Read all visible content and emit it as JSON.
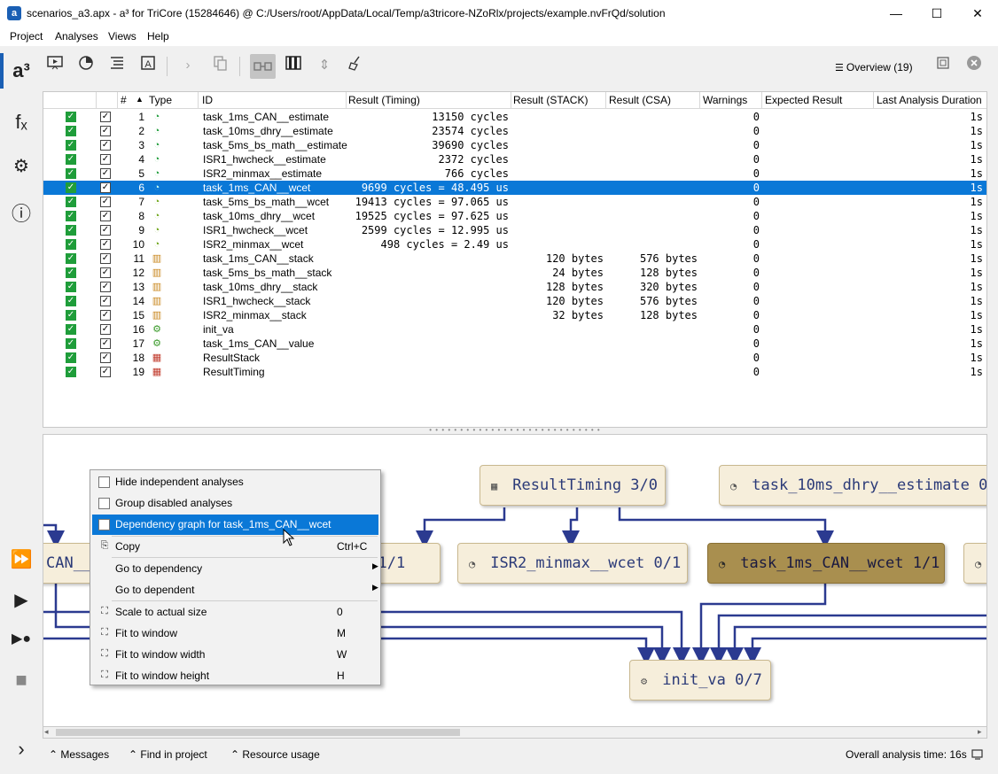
{
  "window": {
    "title": "scenarios_a3.apx - a³ for TriCore (15284646) @ C:/Users/root/AppData/Local/Temp/a3tricore-NZoRlx/projects/example.nvFrQd/solution",
    "minimize": "—",
    "maximize": "☐",
    "close": "✕"
  },
  "menu": {
    "project": "Project",
    "analyses": "Analyses",
    "views": "Views",
    "help": "Help"
  },
  "rail": {
    "logo": "a³",
    "functions": "fₓ",
    "settings": "⚙",
    "info": "ⓘ",
    "run_all": "⏩",
    "run": "▶",
    "run_selected": "▶●",
    "stop": "■",
    "expand": "›"
  },
  "toolbar": {
    "overview_label": "Overview (19)"
  },
  "table": {
    "headers": {
      "hash": "#",
      "type": "Type",
      "id": "ID",
      "timing": "Result (Timing)",
      "stack": "Result (STACK)",
      "csa": "Result (CSA)",
      "warnings": "Warnings",
      "expected": "Expected Result",
      "duration": "Last Analysis Duration"
    },
    "rows": [
      {
        "num": "1",
        "type": "estimate",
        "id": "task_1ms_CAN__estimate",
        "timing": "13150 cycles",
        "stack": "",
        "csa": "",
        "warnings": "0",
        "duration": "1s"
      },
      {
        "num": "2",
        "type": "estimate",
        "id": "task_10ms_dhry__estimate",
        "timing": "23574 cycles",
        "stack": "",
        "csa": "",
        "warnings": "0",
        "duration": "1s"
      },
      {
        "num": "3",
        "type": "estimate",
        "id": "task_5ms_bs_math__estimate",
        "timing": "39690 cycles",
        "stack": "",
        "csa": "",
        "warnings": "0",
        "duration": "1s"
      },
      {
        "num": "4",
        "type": "estimate",
        "id": "ISR1_hwcheck__estimate",
        "timing": "2372 cycles",
        "stack": "",
        "csa": "",
        "warnings": "0",
        "duration": "1s"
      },
      {
        "num": "5",
        "type": "estimate",
        "id": "ISR2_minmax__estimate",
        "timing": "766 cycles",
        "stack": "",
        "csa": "",
        "warnings": "0",
        "duration": "1s"
      },
      {
        "num": "6",
        "type": "wcet",
        "id": "task_1ms_CAN__wcet",
        "timing": "9699 cycles = 48.495 us",
        "stack": "",
        "csa": "",
        "warnings": "0",
        "duration": "1s"
      },
      {
        "num": "7",
        "type": "wcet",
        "id": "task_5ms_bs_math__wcet",
        "timing": "19413 cycles = 97.065 us",
        "stack": "",
        "csa": "",
        "warnings": "0",
        "duration": "1s"
      },
      {
        "num": "8",
        "type": "wcet",
        "id": "task_10ms_dhry__wcet",
        "timing": "19525 cycles = 97.625 us",
        "stack": "",
        "csa": "",
        "warnings": "0",
        "duration": "1s"
      },
      {
        "num": "9",
        "type": "wcet",
        "id": "ISR1_hwcheck__wcet",
        "timing": "2599 cycles = 12.995 us",
        "stack": "",
        "csa": "",
        "warnings": "0",
        "duration": "1s"
      },
      {
        "num": "10",
        "type": "wcet",
        "id": "ISR2_minmax__wcet",
        "timing": "498 cycles = 2.49 us",
        "stack": "",
        "csa": "",
        "warnings": "0",
        "duration": "1s"
      },
      {
        "num": "11",
        "type": "stack",
        "id": "task_1ms_CAN__stack",
        "timing": "",
        "stack": "120 bytes",
        "csa": "576 bytes",
        "warnings": "0",
        "duration": "1s"
      },
      {
        "num": "12",
        "type": "stack",
        "id": "task_5ms_bs_math__stack",
        "timing": "",
        "stack": "24 bytes",
        "csa": "128 bytes",
        "warnings": "0",
        "duration": "1s"
      },
      {
        "num": "13",
        "type": "stack",
        "id": "task_10ms_dhry__stack",
        "timing": "",
        "stack": "128 bytes",
        "csa": "320 bytes",
        "warnings": "0",
        "duration": "1s"
      },
      {
        "num": "14",
        "type": "stack",
        "id": "ISR1_hwcheck__stack",
        "timing": "",
        "stack": "120 bytes",
        "csa": "576 bytes",
        "warnings": "0",
        "duration": "1s"
      },
      {
        "num": "15",
        "type": "stack",
        "id": "ISR2_minmax__stack",
        "timing": "",
        "stack": "32 bytes",
        "csa": "128 bytes",
        "warnings": "0",
        "duration": "1s"
      },
      {
        "num": "16",
        "type": "value",
        "id": "init_va",
        "timing": "",
        "stack": "",
        "csa": "",
        "warnings": "0",
        "duration": "1s"
      },
      {
        "num": "17",
        "type": "value",
        "id": "task_1ms_CAN__value",
        "timing": "",
        "stack": "",
        "csa": "",
        "warnings": "0",
        "duration": "1s"
      },
      {
        "num": "18",
        "type": "report",
        "id": "ResultStack",
        "timing": "",
        "stack": "",
        "csa": "",
        "warnings": "0",
        "duration": "1s"
      },
      {
        "num": "19",
        "type": "report",
        "id": "ResultTiming",
        "timing": "",
        "stack": "",
        "csa": "",
        "warnings": "0",
        "duration": "1s"
      }
    ],
    "selected_row": 6
  },
  "graph": {
    "nodes": {
      "result_timing": "ResultTiming 3/0",
      "dhry_estimate": "task_10ms_dhry__estimate 0/",
      "can_left": "CAN__",
      "wcet_partial": "t 1/1",
      "isr2_wcet": "ISR2_minmax__wcet 0/1",
      "can_wcet": "task_1ms_CAN__wcet 1/1",
      "init_va": "init_va 0/7"
    }
  },
  "context_menu": {
    "hide_independent": "Hide independent analyses",
    "group_disabled": "Group disabled analyses",
    "dependency_graph": "Dependency graph for task_1ms_CAN__wcet",
    "copy": "Copy",
    "copy_shortcut": "Ctrl+C",
    "goto_dependency": "Go to dependency",
    "goto_dependent": "Go to dependent",
    "scale_actual": "Scale to actual size",
    "scale_actual_shortcut": "0",
    "fit_window": "Fit to window",
    "fit_window_shortcut": "M",
    "fit_width": "Fit to window width",
    "fit_width_shortcut": "W",
    "fit_height": "Fit to window height",
    "fit_height_shortcut": "H"
  },
  "bottom": {
    "messages": "Messages",
    "find_in_project": "Find in project",
    "resource_usage": "Resource usage",
    "overall_time": "Overall analysis time: 16s"
  }
}
